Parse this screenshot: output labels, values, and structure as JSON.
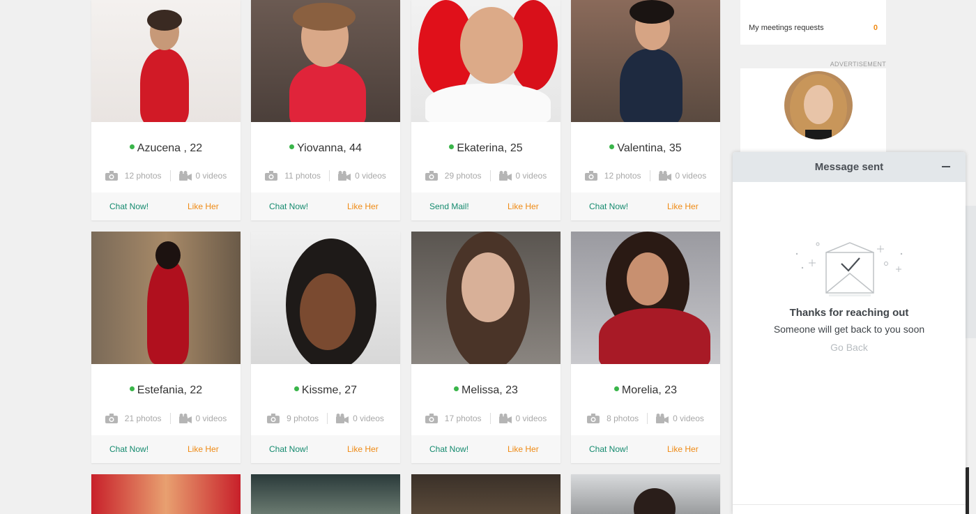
{
  "profiles": [
    {
      "name": "Azucena , 22",
      "photos": "12 photos",
      "videos": "0 videos",
      "action1": "Chat Now!",
      "action2": "Like Her"
    },
    {
      "name": "Yiovanna, 44",
      "photos": "11 photos",
      "videos": "0 videos",
      "action1": "Chat Now!",
      "action2": "Like Her"
    },
    {
      "name": "Ekaterina, 25",
      "photos": "29 photos",
      "videos": "0 videos",
      "action1": "Send Mail!",
      "action2": "Like Her"
    },
    {
      "name": "Valentina, 35",
      "photos": "12 photos",
      "videos": "0 videos",
      "action1": "Chat Now!",
      "action2": "Like Her"
    },
    {
      "name": "Estefania, 22",
      "photos": "21 photos",
      "videos": "0 videos",
      "action1": "Chat Now!",
      "action2": "Like Her"
    },
    {
      "name": "Kissme, 27",
      "photos": "9 photos",
      "videos": "0 videos",
      "action1": "Chat Now!",
      "action2": "Like Her"
    },
    {
      "name": "Melissa, 23",
      "photos": "17 photos",
      "videos": "0 videos",
      "action1": "Chat Now!",
      "action2": "Like Her"
    },
    {
      "name": "Morelia, 23",
      "photos": "8 photos",
      "videos": "0 videos",
      "action1": "Chat Now!",
      "action2": "Like Her"
    }
  ],
  "sidebar": {
    "meetings_label": "My meetings requests",
    "meetings_count": "0",
    "ad_label": "ADVERTISEMENT"
  },
  "chat": {
    "title": "Message sent",
    "thanks": "Thanks for reaching out",
    "subtitle": "Someone will get back to you soon",
    "go_back": "Go Back"
  },
  "colors": {
    "online": "#3ab54a",
    "chat_action": "#148a6e",
    "like_action": "#ef8a14"
  }
}
